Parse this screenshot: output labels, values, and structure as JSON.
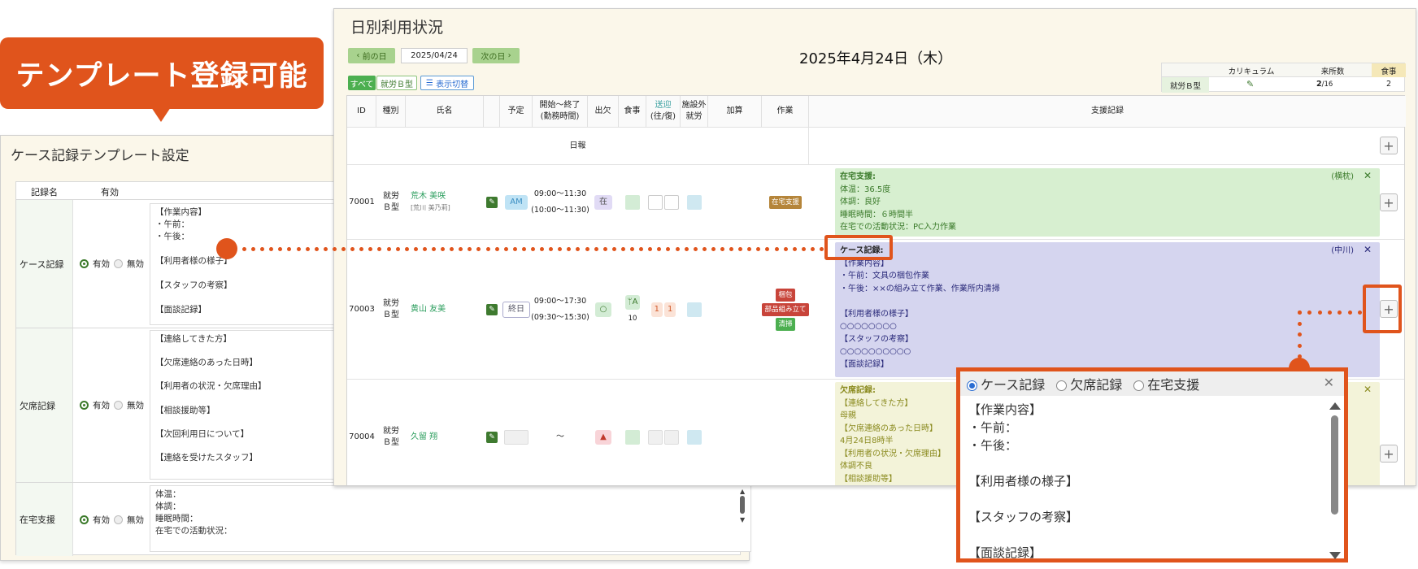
{
  "callout": {
    "label": "テンプレート登録可能"
  },
  "template_panel": {
    "title": "ケース記録テンプレート設定",
    "col_name": "記録名",
    "col_enabled": "有効",
    "radio_on": "有効",
    "radio_off": "無効",
    "rows": [
      {
        "name": "ケース記録",
        "text": "【作業内容】\n・午前：\n・午後：\n\n【利用者様の様子】\n\n【スタッフの考察】\n\n【面談記録】"
      },
      {
        "name": "欠席記録",
        "text": "【連絡してきた方】\n\n【欠席連絡のあった日時】\n\n【利用者の状況・欠席理由】\n\n【相談援助等】\n\n【次回利用日について】\n\n【連絡を受けたスタッフ】"
      },
      {
        "name": "在宅支援",
        "text": "体温：\n体調：\n睡眠時間：\n在宅での活動状況："
      }
    ]
  },
  "daily": {
    "title": "日別利用状況",
    "prev_label": "前の日",
    "next_label": "次の日",
    "date_value": "2025/04/24",
    "date_heading": "2025年4月24日（木）",
    "filter_all": "すべて",
    "filter_type": "就労Ｂ型",
    "toggle_label": "表示切替",
    "summary": {
      "curriculum_label": "カリキュラム",
      "visits_label": "来所数",
      "meal_label": "食事",
      "type_label": "就労Ｂ型",
      "visits_value": "2",
      "visits_total": "/16",
      "meal_value": "2"
    },
    "headers": {
      "id": "ID",
      "kind": "種別",
      "name": "氏名",
      "plan": "予定",
      "time": "開始～終了\n(勤務時間)",
      "att": "出欠",
      "meal": "食事",
      "transport": "送迎",
      "transport_sub": "(往/復)",
      "outside": "施設外\n就労",
      "addition": "加算",
      "work": "作業",
      "support": "支援記録"
    },
    "daily_report_label": "日報",
    "rows": [
      {
        "id": "70001",
        "kind": "就労\nＢ型",
        "name": "荒木 美咲",
        "kana": "[荒川 美乃莉]",
        "plan": "AM",
        "time": "09:00～11:30\n(10:00～11:30)",
        "att": "在",
        "work": [
          "在宅支援"
        ],
        "note": {
          "title": "在宅支援:",
          "signer": "(横枕)",
          "body": "体温：36.5度\n体調：良好\n睡眠時間：６時間半\n在宅での活動状況：PC入力作業"
        }
      },
      {
        "id": "70003",
        "kind": "就労\nＢ型",
        "name": "黄山 友美",
        "kana": "",
        "plan": "終日",
        "time": "09:00～17:30\n(09:30～15:30)",
        "att": "○",
        "meal": "A",
        "meal_count": "10",
        "trans_out": "1",
        "trans_back": "1",
        "work": [
          "梱包",
          "部品組み立て",
          "清掃"
        ],
        "note": {
          "title": "ケース記録:",
          "signer": "(中川)",
          "body": "【作業内容】\n・午前：文具の梱包作業\n・午後：××の組み立て作業、作業所内清掃\n\n【利用者様の様子】\n○○○○○○○○\n【スタッフの考察】\n○○○○○○○○○○\n【面談記録】"
        }
      },
      {
        "id": "70004",
        "kind": "就労\nＢ型",
        "name": "久留 翔",
        "kana": "",
        "plan": "",
        "time": "～",
        "att": "▲",
        "work": [],
        "note": {
          "title": "欠席記録:",
          "signer": "",
          "body": "【連絡してきた方】\n母親\n【欠席連絡のあった日時】\n4月24日8時半\n【利用者の状況・欠席理由】\n体調不良\n【相談援助等】"
        }
      }
    ]
  },
  "popup": {
    "options": [
      "ケース記録",
      "欠席記録",
      "在宅支援"
    ],
    "selected": "ケース記録",
    "text": "【作業内容】\n・午前：\n・午後：\n\n【利用者様の様子】\n\n【スタッフの考察】\n\n【面談記録】"
  },
  "colors": {
    "accent": "#e0541c",
    "green": "#3e7a2f",
    "note_green": "#d7efd0",
    "note_purple": "#d5d5ef",
    "note_yellow": "#f3f3d9"
  }
}
